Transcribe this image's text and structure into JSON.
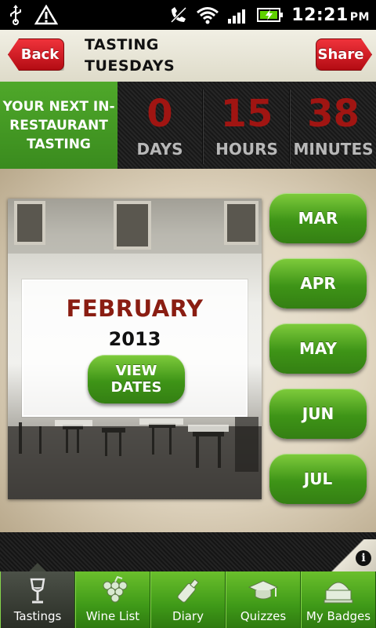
{
  "status_bar": {
    "time": "12:21",
    "ampm": "PM",
    "icons": [
      "usb-icon",
      "warning-icon",
      "phone-off-icon",
      "wifi-icon",
      "signal-icon",
      "battery-charging-icon"
    ]
  },
  "header": {
    "back_label": "Back",
    "title_line1": "TASTING",
    "title_line2": "TUESDAYS",
    "share_label": "Share"
  },
  "countdown": {
    "label": "YOUR NEXT IN-RESTAURANT TASTING",
    "days": {
      "value": "0",
      "caption": "DAYS"
    },
    "hours": {
      "value": "15",
      "caption": "HOURS"
    },
    "minutes": {
      "value": "38",
      "caption": "MINUTES"
    }
  },
  "featured": {
    "month": "FEBRUARY",
    "year": "2013",
    "view_dates_label": "VIEW DATES"
  },
  "months": [
    "MAR",
    "APR",
    "MAY",
    "JUN",
    "JUL"
  ],
  "tabs": [
    {
      "label": "Tastings",
      "icon": "wine-glass-icon",
      "active": true
    },
    {
      "label": "Wine List",
      "icon": "grapes-icon",
      "active": false
    },
    {
      "label": "Diary",
      "icon": "wine-bottle-icon",
      "active": false
    },
    {
      "label": "Quizzes",
      "icon": "graduation-cap-icon",
      "active": false
    },
    {
      "label": "My Badges",
      "icon": "badge-icon",
      "active": false
    }
  ],
  "colors": {
    "accent_green": "#3e9417",
    "accent_red": "#c1151c",
    "countdown_number": "#a01512",
    "month_name": "#8a1d12"
  }
}
